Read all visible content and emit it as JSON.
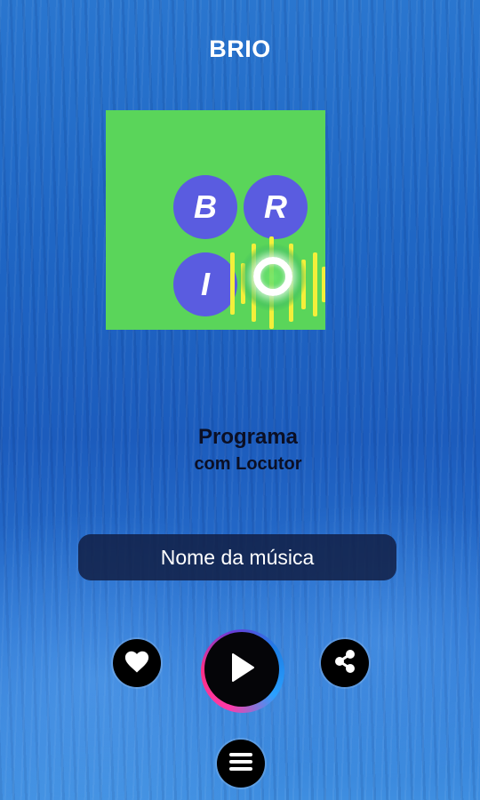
{
  "header": {
    "title": "BRIO"
  },
  "cover": {
    "letters": [
      "B",
      "R",
      "I",
      "O"
    ],
    "background_color": "#5ad55a",
    "circle_color": "#5a5ce0",
    "visualizer_color": "#f4ef3a"
  },
  "program": {
    "title": "Programa",
    "host": "com Locutor"
  },
  "now_playing": {
    "song_name": "Nome da música"
  },
  "controls": {
    "like_icon": "heart-icon",
    "play_icon": "play-icon",
    "share_icon": "share-icon",
    "menu_icon": "menu-icon"
  }
}
